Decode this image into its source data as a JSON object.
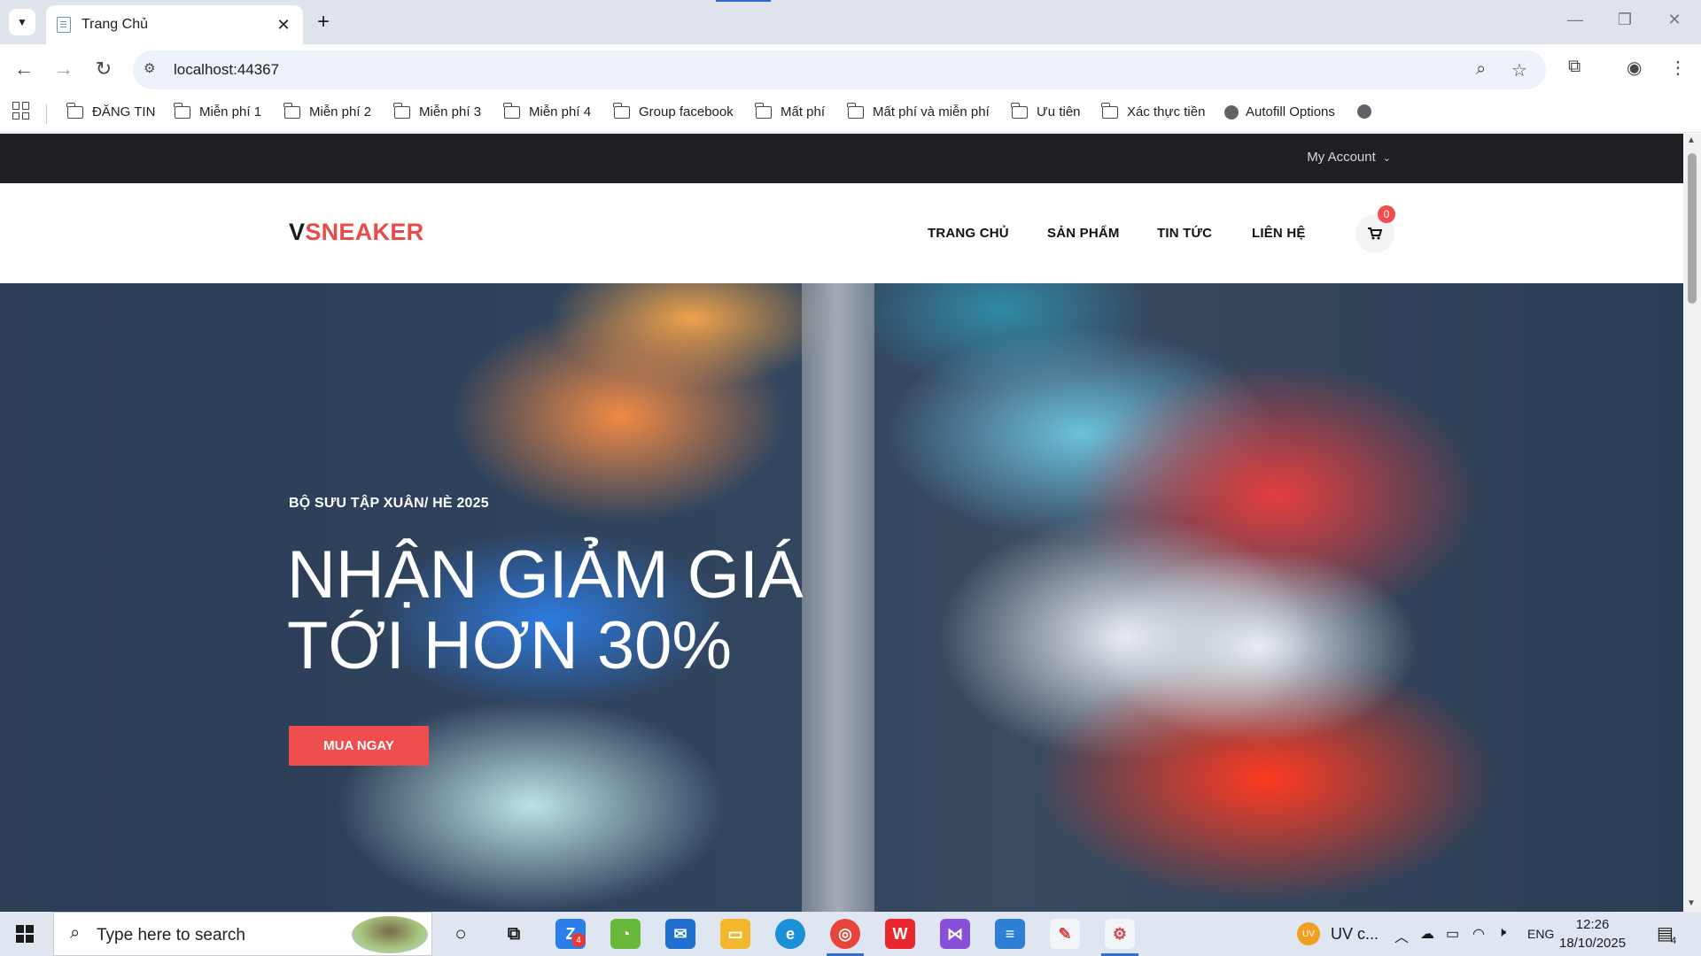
{
  "browser": {
    "tab_title": "Trang Chủ",
    "url": "localhost:44367",
    "bookmarks": [
      {
        "label": "ĐĂNG TIN",
        "icon": "folder-icon"
      },
      {
        "label": "Miễn phí 1",
        "icon": "folder-icon"
      },
      {
        "label": "Miễn phí 2",
        "icon": "folder-icon"
      },
      {
        "label": "Miễn phí 3",
        "icon": "folder-icon"
      },
      {
        "label": "Miễn phí 4",
        "icon": "folder-icon"
      },
      {
        "label": "Group facebook",
        "icon": "folder-icon"
      },
      {
        "label": "Mất phí",
        "icon": "folder-icon"
      },
      {
        "label": "Mất phí và miễn phí",
        "icon": "folder-icon"
      },
      {
        "label": "Ưu tiên",
        "icon": "folder-icon"
      },
      {
        "label": "Xác thực tiền",
        "icon": "folder-icon"
      },
      {
        "label": "Autofill Options",
        "icon": "globe-icon"
      }
    ]
  },
  "site": {
    "account_label": "My Account",
    "logo_first": "V",
    "logo_rest": "SNEAKER",
    "menu": [
      "TRANG CHỦ",
      "SẢN PHẨM",
      "TIN TỨC",
      "LIÊN HỆ"
    ],
    "cart_count": "0",
    "brand_color": "#f04e4e",
    "hero": {
      "subtitle": "BỘ SƯU TẬP XUÂN/ HÈ 2025",
      "title_line1": "NHẬN GIẢM GIÁ",
      "title_line2": "TỚI HƠN 30%",
      "button": "MUA NGAY"
    }
  },
  "taskbar": {
    "search_placeholder": "Type here to search",
    "tray_user_label": "UV c...",
    "user_initials": "UV",
    "language": "ENG",
    "time": "12:26",
    "date": "18/10/2025",
    "notification_count": "4",
    "zalo_badge": "4"
  }
}
